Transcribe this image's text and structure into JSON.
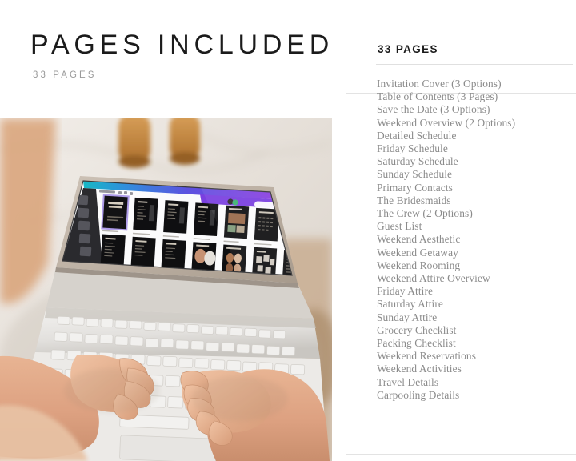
{
  "left": {
    "heading": "PAGES INCLUDED",
    "subheading": "33 PAGES"
  },
  "photo": {
    "alt_description": "overhead photo of hands typing on a white laptop showing a dark template grid in a design app, on a marble table with two amber glasses",
    "icon": "laptop-photo"
  },
  "card": {
    "title": "33 PAGES",
    "items": [
      "Invitation Cover (3 Options)",
      "Table of Contents (3 Pages)",
      "Save the Date (3 Options)",
      "Weekend Overview (2 Options)",
      "Detailed Schedule",
      "Friday Schedule",
      "Saturday Schedule",
      "Sunday Schedule",
      "Primary Contacts",
      "The Bridesmaids",
      "The Crew (2 Options)",
      "Guest List",
      "Weekend Aesthetic",
      "Weekend Getaway",
      "Weekend Rooming",
      "Weekend Attire Overview",
      "Friday Attire",
      "Saturday Attire",
      "Sunday Attire",
      "Grocery Checklist",
      "Packing Checklist",
      "Weekend Reservations",
      "Weekend Activities",
      "Travel Details",
      "Carpooling Details"
    ]
  },
  "colors": {
    "background": "#ffffff",
    "heading_text": "#1b1b1b",
    "subheading_text": "#9a9a9a",
    "list_text": "#8b8b8b",
    "card_border": "#e3e3e3",
    "divider": "#e0e0e0"
  }
}
